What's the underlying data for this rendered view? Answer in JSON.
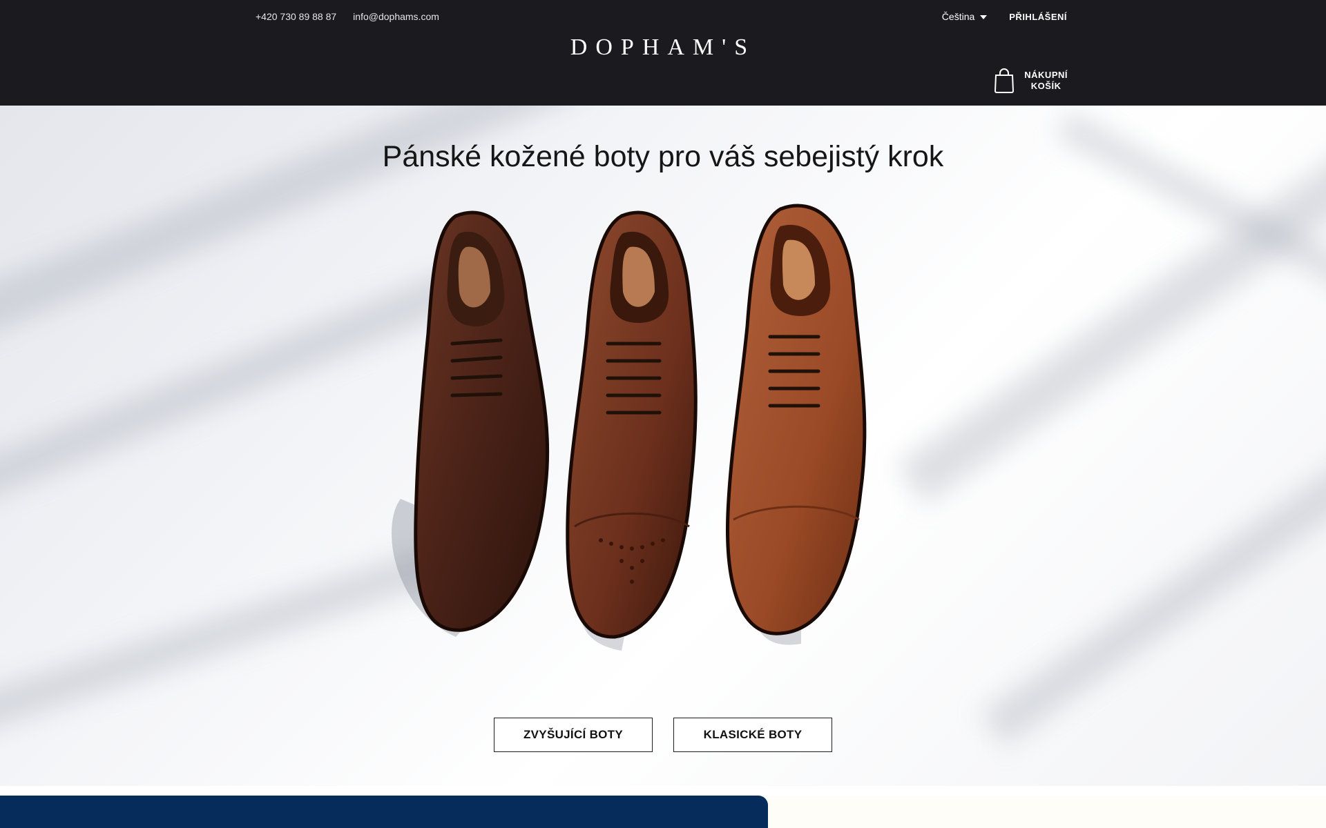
{
  "header": {
    "phone": "+420 730 89 88 87",
    "email": "info@dophams.com",
    "language": "Čeština",
    "login": "PŘIHLÁŠENÍ",
    "logo": "DOPHAM'S",
    "cart_line1": "NÁKUPNÍ",
    "cart_line2": "KOŠÍK"
  },
  "hero": {
    "title": "Pánské kožené boty pro váš sebejistý krok",
    "buttons": [
      "ZVYŠUJÍCÍ BOTY",
      "KLASICKÉ BOTY"
    ]
  },
  "colors": {
    "header_bg": "#1b1a1f",
    "bottom_band": "#052c5a"
  },
  "icons": {
    "cart": "shopping-bag-icon",
    "language_caret": "caret-down-icon"
  }
}
